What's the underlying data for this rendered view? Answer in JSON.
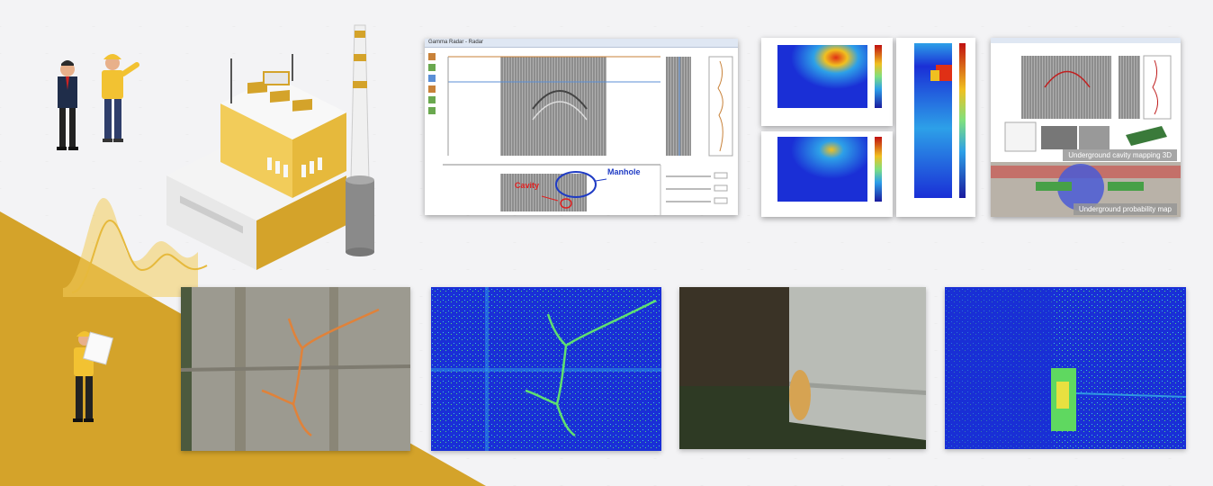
{
  "gpr_viewer": {
    "window_title": "Gamma Radar - Radar",
    "labels": {
      "manhole": "Manhole",
      "cavity": "Cavity"
    }
  },
  "mapping_panel": {
    "captions": {
      "cavity_mapping": "Underground cavity mapping 3D",
      "probability_map": "Underground probability map"
    }
  },
  "colors": {
    "accent_gold": "#d4a32a",
    "gold_light": "#f2cc5a",
    "jet_blue": "#1a2fd6",
    "jet_red": "#e03015"
  },
  "icons": [
    "engineer-icon",
    "worker-icon",
    "factory-icon",
    "chimney-icon",
    "wave-chart-icon",
    "inspector-icon"
  ]
}
